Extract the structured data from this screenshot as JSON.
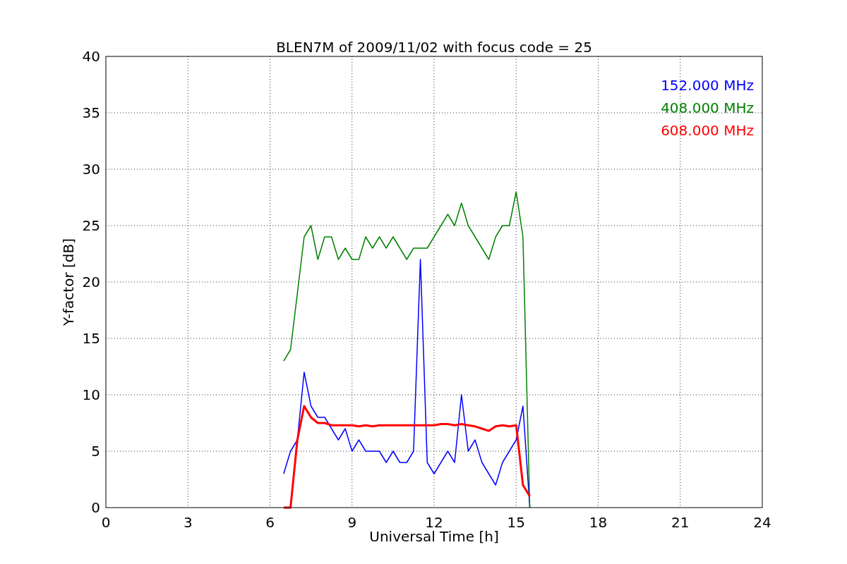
{
  "figure": {
    "chart_data": {
      "type": "line",
      "title": "BLEN7M of 2009/11/02 with focus code = 25",
      "xlabel": "Universal Time [h]",
      "ylabel": "Y-factor [dB]",
      "x": [
        6.5,
        6.75,
        7.0,
        7.25,
        7.5,
        7.75,
        8.0,
        8.25,
        8.5,
        8.75,
        9.0,
        9.25,
        9.5,
        9.75,
        10.0,
        10.25,
        10.5,
        10.75,
        11.0,
        11.25,
        11.5,
        11.75,
        12.0,
        12.25,
        12.5,
        12.75,
        13.0,
        13.25,
        13.5,
        13.75,
        14.0,
        14.25,
        14.5,
        14.75,
        15.0,
        15.25,
        15.5
      ],
      "series": [
        {
          "name": "152.000 MHz",
          "color": "#0000ff",
          "values": [
            3,
            5,
            6,
            12,
            9,
            8,
            8,
            7,
            6,
            7,
            5,
            6,
            5,
            5,
            5,
            4,
            5,
            4,
            4,
            5,
            22,
            4,
            3,
            4,
            5,
            4,
            10,
            5,
            6,
            4,
            3,
            2,
            4,
            5,
            6,
            9,
            0
          ]
        },
        {
          "name": "408.000 MHz",
          "color": "#008000",
          "values": [
            13,
            14,
            19,
            24,
            25,
            22,
            24,
            24,
            22,
            23,
            22,
            22,
            24,
            23,
            24,
            23,
            24,
            23,
            22,
            23,
            23,
            23,
            24,
            25,
            26,
            25,
            27,
            25,
            24,
            23,
            22,
            24,
            25,
            25,
            28,
            24,
            0
          ]
        },
        {
          "name": "608.000 MHz",
          "color": "#ff0000",
          "values": [
            0,
            0,
            6,
            9,
            8,
            7.5,
            7.5,
            7.3,
            7.3,
            7.3,
            7.3,
            7.2,
            7.3,
            7.2,
            7.3,
            7.3,
            7.3,
            7.3,
            7.3,
            7.3,
            7.3,
            7.3,
            7.3,
            7.4,
            7.4,
            7.3,
            7.4,
            7.3,
            7.2,
            7,
            6.8,
            7.2,
            7.3,
            7.2,
            7.3,
            2,
            1
          ]
        }
      ],
      "grid": true,
      "xlim": [
        0,
        24
      ],
      "ylim": [
        0,
        40
      ],
      "xticks": [
        0,
        3,
        6,
        9,
        12,
        15,
        18,
        21,
        24
      ],
      "yticks": [
        0,
        5,
        10,
        15,
        20,
        25,
        30,
        35,
        40
      ]
    }
  }
}
